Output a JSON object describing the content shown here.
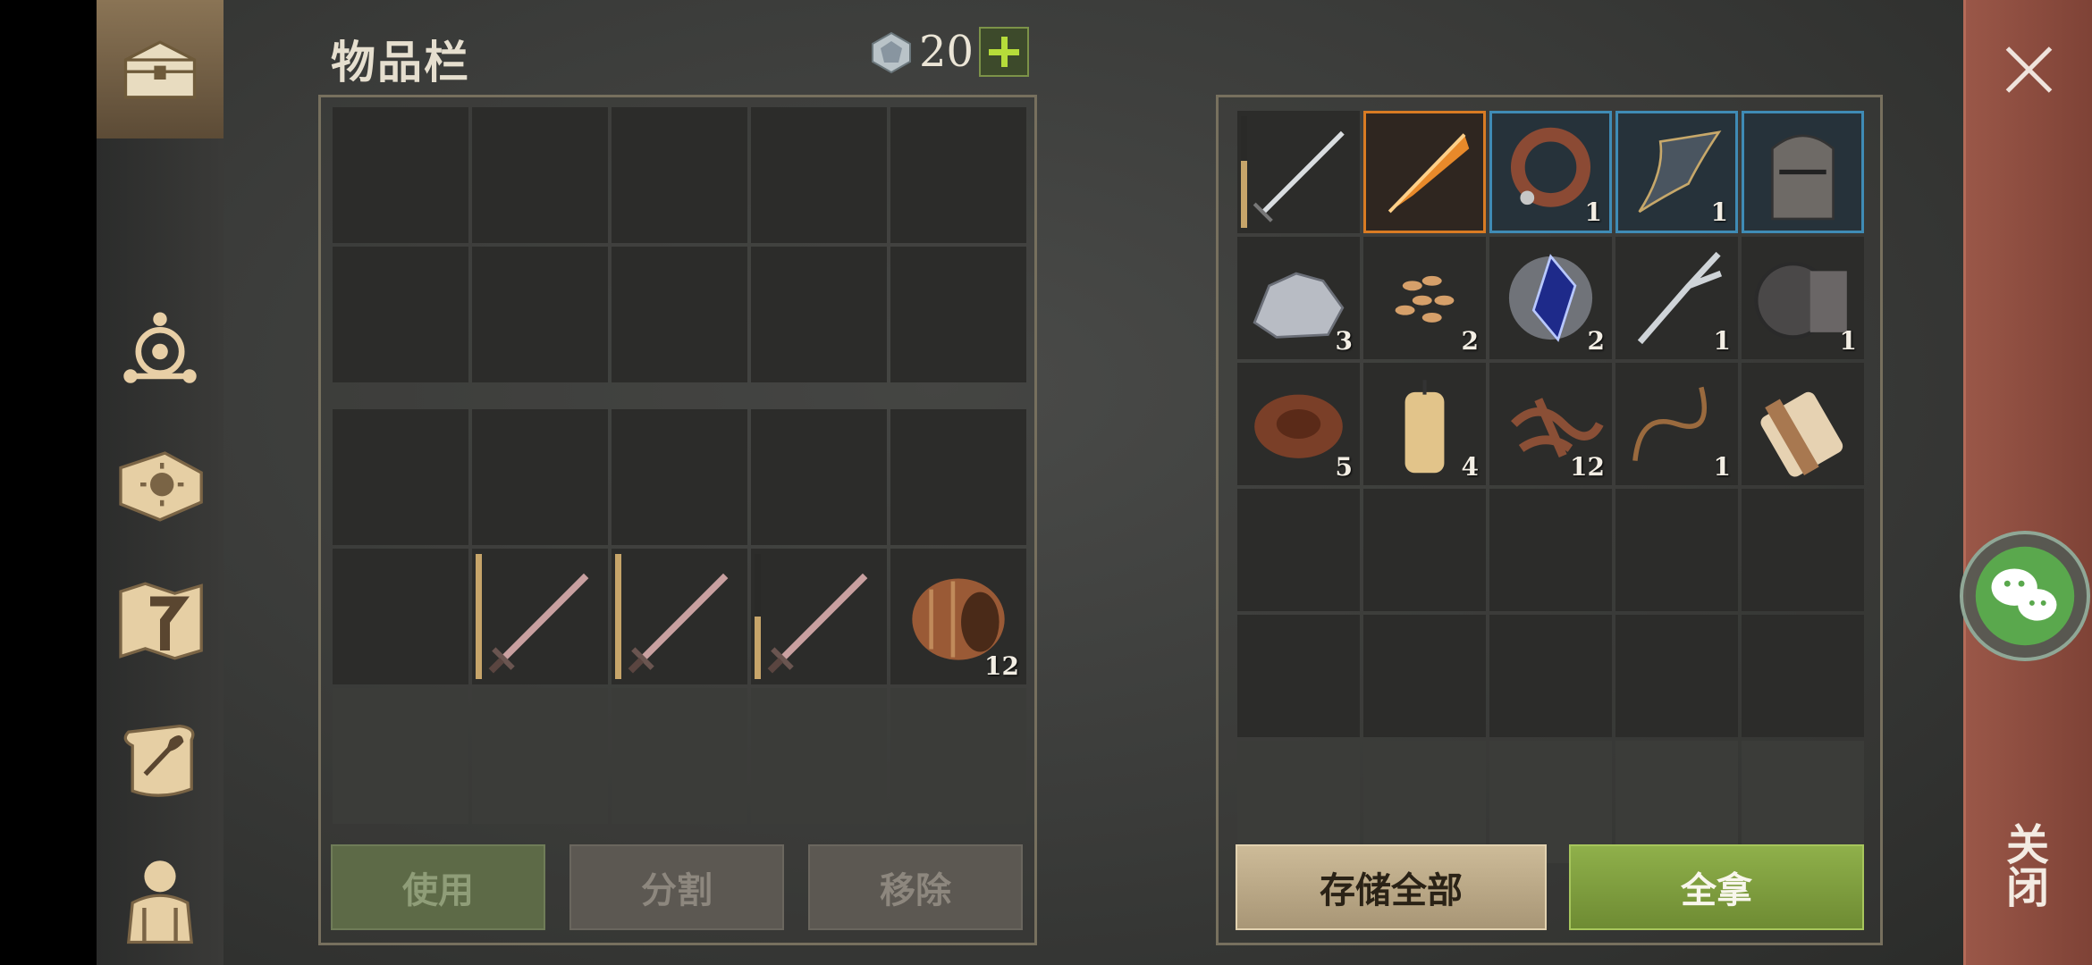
{
  "header": {
    "title": "物品栏",
    "gem_count": "20",
    "add_icon": "plus-icon"
  },
  "nav": {
    "items": [
      {
        "icon": "chest-icon",
        "active": true
      },
      {
        "icon": "crafting-icon"
      },
      {
        "icon": "skill-book-icon"
      },
      {
        "icon": "map-icon"
      },
      {
        "icon": "scroll-quill-icon"
      },
      {
        "icon": "character-icon"
      }
    ]
  },
  "inventory": {
    "equipped_rows": 2,
    "backpack": [
      {
        "row": 2,
        "col": 2,
        "item": "sword",
        "durability": 1.0
      },
      {
        "row": 2,
        "col": 3,
        "item": "sword",
        "durability": 1.0
      },
      {
        "row": 2,
        "col": 4,
        "item": "sword",
        "durability": 0.5
      },
      {
        "row": 2,
        "col": 5,
        "item": "barrel",
        "count": "12"
      }
    ]
  },
  "storage": {
    "items": [
      {
        "item": "steel-sword",
        "durability": 0.6
      },
      {
        "item": "flame-sword",
        "frame": "orange"
      },
      {
        "item": "leather-collar",
        "count": "1",
        "frame": "blue"
      },
      {
        "item": "ornate-bow",
        "count": "1",
        "frame": "blue"
      },
      {
        "item": "knight-helmet",
        "frame": "blue"
      },
      {
        "item": "iron-ore",
        "count": "3"
      },
      {
        "item": "seeds",
        "count": "2"
      },
      {
        "item": "magic-crystal",
        "count": "2"
      },
      {
        "item": "fork",
        "count": "1"
      },
      {
        "item": "gear-part",
        "count": "1"
      },
      {
        "item": "leather-roll",
        "count": "5"
      },
      {
        "item": "candle",
        "count": "4"
      },
      {
        "item": "rope-scraps",
        "count": "12"
      },
      {
        "item": "whip-rope",
        "count": "1"
      },
      {
        "item": "scroll-bundle"
      }
    ]
  },
  "buttons": {
    "use": "使用",
    "split": "分割",
    "remove": "移除",
    "store_all": "存储全部",
    "take_all": "全拿"
  },
  "close": {
    "label": "关闭"
  },
  "colors": {
    "accent_green": "#8fb04a",
    "frame_orange": "#d97b23",
    "frame_blue": "#3f8bb5"
  }
}
